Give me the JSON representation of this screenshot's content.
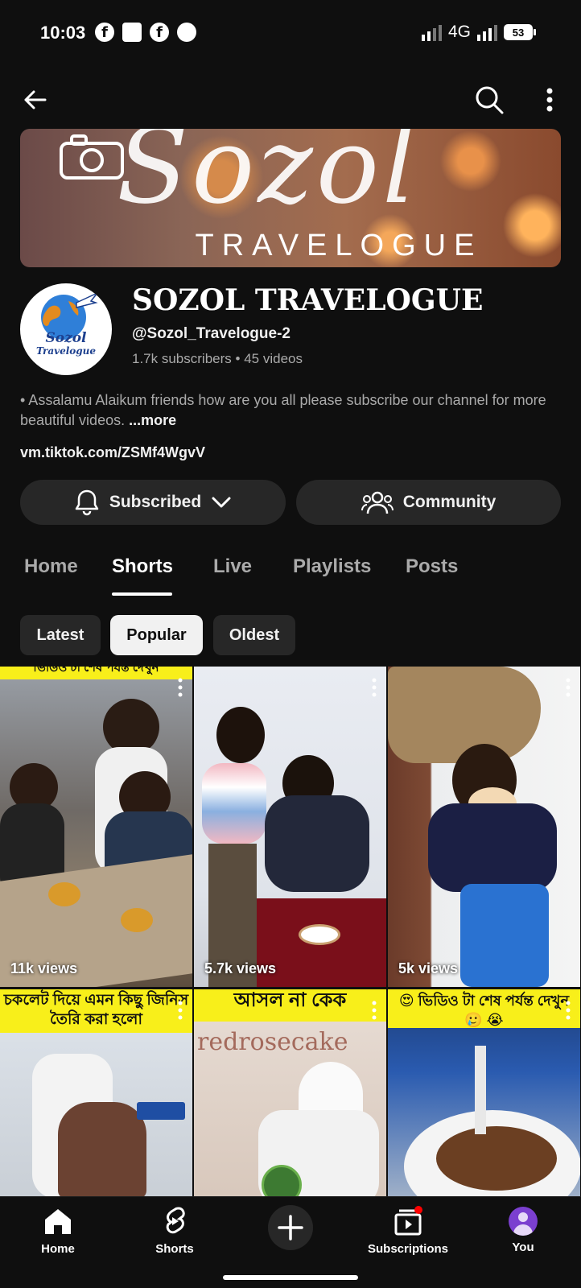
{
  "status_bar": {
    "time": "10:03",
    "network": "4G",
    "battery": "53"
  },
  "banner": {
    "script_text": "Sozol",
    "subtitle": "TRAVELOGUE"
  },
  "channel": {
    "name": "SOZOL TRAVELOGUE",
    "handle": "@Sozol_Travelogue-2",
    "subscribers": "1.7k subscribers",
    "videos": "45 videos",
    "avatar_text": "Sozol",
    "avatar_subtext": "Travelogue",
    "description": "• Assalamu Alaikum friends how are you all please subscribe our channel for more beautiful videos.",
    "more_label": "...more",
    "link": "vm.tiktok.com/ZSMf4WgvV"
  },
  "actions": {
    "subscribed_label": "Subscribed",
    "community_label": "Community"
  },
  "tabs": [
    {
      "label": "Home"
    },
    {
      "label": "Shorts"
    },
    {
      "label": "Live"
    },
    {
      "label": "Playlists"
    },
    {
      "label": "Posts"
    }
  ],
  "active_tab": "Shorts",
  "sort_chips": [
    {
      "label": "Latest"
    },
    {
      "label": "Popular"
    },
    {
      "label": "Oldest"
    }
  ],
  "active_chip": "Popular",
  "shorts": [
    {
      "views": "11k views",
      "caption": "ভিডিও টা শেষ পর্যন্ত দেখুন"
    },
    {
      "views": "5.7k views",
      "caption": ""
    },
    {
      "views": "5k views",
      "caption": ""
    },
    {
      "views": "",
      "caption": "চকলেট দিয়ে এমন কিছু জিনিস তৈরি করা হলো"
    },
    {
      "views": "",
      "caption": "আসল না কেক",
      "overlay": "redrosecake"
    },
    {
      "views": "",
      "caption": "😍 ভিডিও টা শেষ পর্যন্ত দেখুন 🥲 😭"
    }
  ],
  "bottom_nav": {
    "home": "Home",
    "shorts": "Shorts",
    "subscriptions": "Subscriptions",
    "you": "You"
  },
  "colors": {
    "background": "#0f0f0f",
    "chip_bg": "#272727",
    "caption_yellow": "#f8ef1a",
    "notification_red": "#ff0000",
    "you_avatar": "#7b3fd0"
  }
}
